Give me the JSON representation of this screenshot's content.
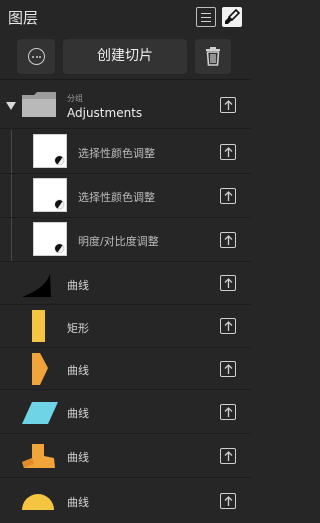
{
  "header": {
    "title": "图层"
  },
  "toolbar": {
    "create_slice_label": "创建切片"
  },
  "group": {
    "sublabel": "分组",
    "name": "Adjustments"
  },
  "adjustments": [
    {
      "label": "选择性颜色调整"
    },
    {
      "label": "选择性颜色调整"
    },
    {
      "label": "明度/对比度调整"
    }
  ],
  "layers": [
    {
      "label": "曲线",
      "shape": "black-curve-shape"
    },
    {
      "label": "矩形",
      "shape": "yellow-rectangle-shape"
    },
    {
      "label": "曲线",
      "shape": "orange-pentagon-shape"
    },
    {
      "label": "曲线",
      "shape": "cyan-parallelogram-shape"
    },
    {
      "label": "曲线",
      "shape": "orange-boot-shape"
    },
    {
      "label": "曲线",
      "shape": "yellow-semicircle-shape"
    }
  ],
  "colors": {
    "panel_bg": "#262626",
    "accent_yellow": "#f5c542",
    "accent_orange": "#f0a43a",
    "accent_cyan": "#6fd4e6"
  }
}
